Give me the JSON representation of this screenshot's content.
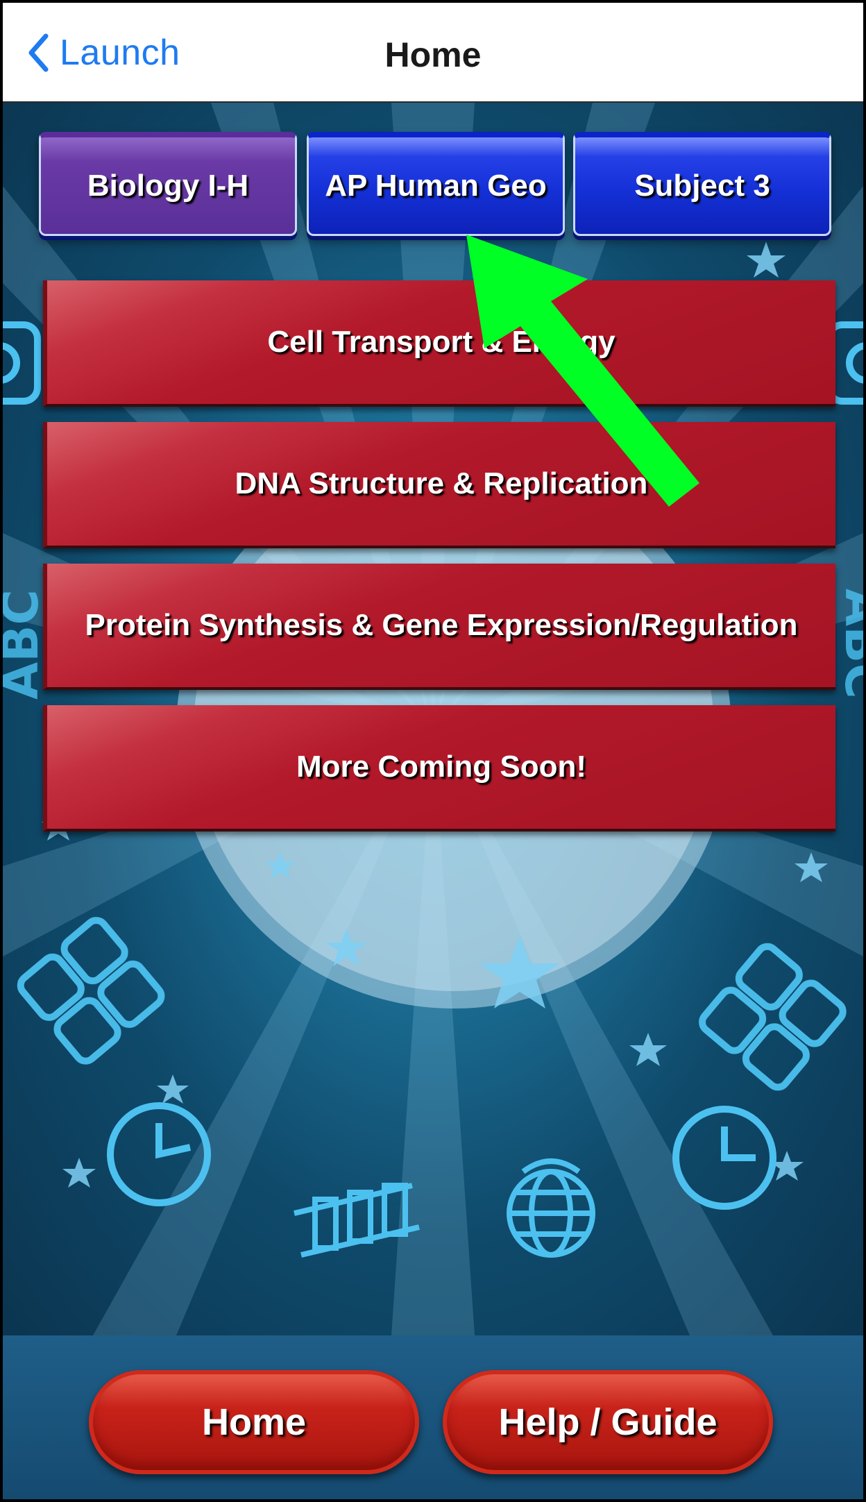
{
  "navbar": {
    "back_label": "Launch",
    "title": "Home"
  },
  "subject_tabs": [
    {
      "label": "Biology I-H",
      "selected": true
    },
    {
      "label": "AP Human Geo",
      "selected": false
    },
    {
      "label": "Subject 3",
      "selected": false
    }
  ],
  "topics": [
    {
      "label": "Cell Transport & Energy"
    },
    {
      "label": "DNA Structure & Replication"
    },
    {
      "label": "Protein Synthesis & Gene Expression/Regulation"
    },
    {
      "label": "More Coming Soon!"
    }
  ],
  "bottom_bar": {
    "home_label": "Home",
    "help_label": "Help / Guide"
  },
  "icons": {
    "back": "chevron-left-icon",
    "annotation": "green-arrow-icon",
    "decor": [
      "star-icon",
      "calculator-icon",
      "clock-icon",
      "globe-icon",
      "abc-icon"
    ]
  },
  "colors": {
    "ios_blue": "#1e7bf0",
    "tab_blue": "#1430d6",
    "tab_selected_purple": "#5a2f98",
    "topic_red": "#b2192a",
    "pill_red": "#c8221a",
    "arrow_green": "#00ff24",
    "background_teal": "#1c6f96"
  }
}
